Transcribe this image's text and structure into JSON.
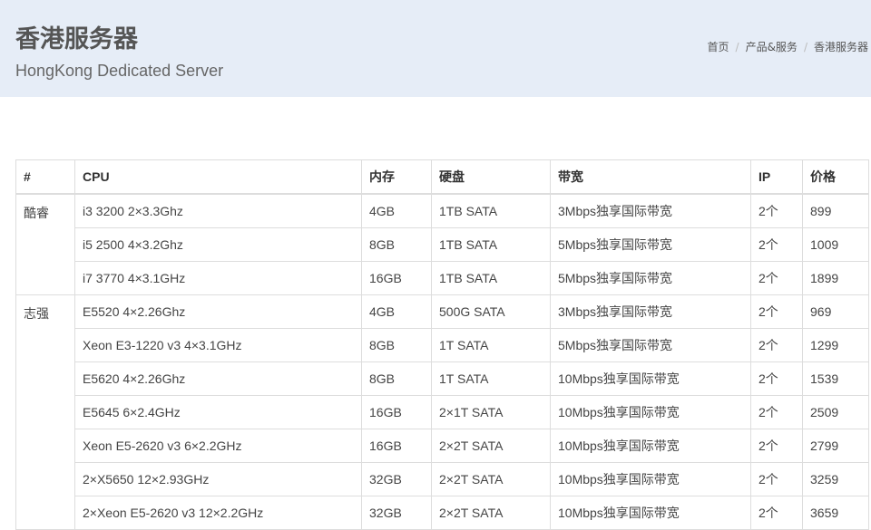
{
  "header": {
    "title": "香港服务器",
    "subtitle": "HongKong Dedicated Server",
    "breadcrumb": [
      "首页",
      "产品&服务",
      "香港服务器"
    ],
    "background_color": "#e6edf7"
  },
  "table": {
    "columns": [
      "#",
      "CPU",
      "内存",
      "硬盘",
      "带宽",
      "IP",
      "价格"
    ],
    "groups": [
      {
        "label": "酷睿",
        "rows": [
          [
            "i3 3200 2×3.3Ghz",
            "4GB",
            "1TB SATA",
            "3Mbps独享国际带宽",
            "2个",
            "899"
          ],
          [
            "i5 2500 4×3.2Ghz",
            "8GB",
            "1TB SATA",
            "5Mbps独享国际带宽",
            "2个",
            "1009"
          ],
          [
            "i7 3770 4×3.1GHz",
            "16GB",
            "1TB SATA",
            "5Mbps独享国际带宽",
            "2个",
            "1899"
          ]
        ]
      },
      {
        "label": "志强",
        "rows": [
          [
            "E5520 4×2.26Ghz",
            "4GB",
            "500G SATA",
            "3Mbps独享国际带宽",
            "2个",
            "969"
          ],
          [
            "Xeon E3-1220 v3 4×3.1GHz",
            "8GB",
            "1T SATA",
            "5Mbps独享国际带宽",
            "2个",
            "1299"
          ],
          [
            "E5620 4×2.26Ghz",
            "8GB",
            "1T SATA",
            "10Mbps独享国际带宽",
            "2个",
            "1539"
          ],
          [
            "E5645 6×2.4GHz",
            "16GB",
            "2×1T SATA",
            "10Mbps独享国际带宽",
            "2个",
            "2509"
          ],
          [
            "Xeon E5-2620 v3 6×2.2GHz",
            "16GB",
            "2×2T SATA",
            "10Mbps独享国际带宽",
            "2个",
            "2799"
          ],
          [
            "2×X5650 12×2.93GHz",
            "32GB",
            "2×2T SATA",
            "10Mbps独享国际带宽",
            "2个",
            "3259"
          ],
          [
            "2×Xeon E5-2620 v3 12×2.2GHz",
            "32GB",
            "2×2T SATA",
            "10Mbps独享国际带宽",
            "2个",
            "3659"
          ]
        ]
      }
    ]
  }
}
